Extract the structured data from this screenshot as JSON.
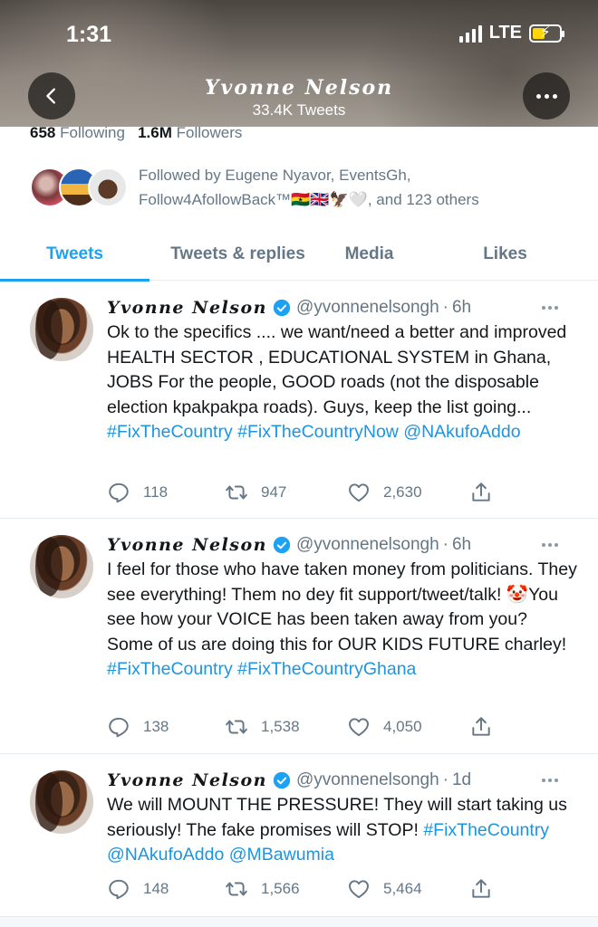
{
  "status_bar": {
    "time": "1:31",
    "network": "LTE"
  },
  "header": {
    "name": "Yvonne Nelson",
    "tweet_count": "33.4K Tweets"
  },
  "profile": {
    "following_count": "658",
    "following_label": "Following",
    "followers_count": "1.6M",
    "followers_label": "Followers",
    "followed_by": "Followed by Eugene Nyavor, EventsGh, Follow4AfollowBack™🇬🇭🇬🇧🦅🤍, and 123 others"
  },
  "tabs": [
    {
      "label": "Tweets",
      "active": true
    },
    {
      "label": "Tweets & replies",
      "active": false
    },
    {
      "label": "Media",
      "active": false
    },
    {
      "label": "Likes",
      "active": false
    }
  ],
  "colors": {
    "accent": "#1da1f2",
    "link": "#1b95e0",
    "secondary_text": "#657786"
  },
  "tweets": [
    {
      "name": "Yvonne Nelson",
      "handle": "@yvonnenelsongh",
      "time": "6h",
      "text": "Ok to the specifics .... we want/need a better and improved HEALTH SECTOR , EDUCATIONAL SYSTEM in Ghana, JOBS For the people, GOOD roads (not the disposable election kpakpakpa roads). Guys, keep the list going... ",
      "links": [
        "#FixTheCountry",
        "#FixTheCountryNow",
        "@NAkufoAddo"
      ],
      "replies": "118",
      "retweets": "947",
      "likes": "2,630"
    },
    {
      "name": "Yvonne Nelson",
      "handle": "@yvonnenelsongh",
      "time": "6h",
      "text": "I feel for those who have taken money from politicians. They see everything! Them no dey fit support/tweet/talk! 🤡You see how your VOICE has been taken away from you? Some of us are doing this for OUR KIDS FUTURE charley! ",
      "links": [
        "#FixTheCountry",
        "#FixTheCountryGhana"
      ],
      "replies": "138",
      "retweets": "1,538",
      "likes": "4,050"
    },
    {
      "name": "Yvonne Nelson",
      "handle": "@yvonnenelsongh",
      "time": "1d",
      "text": "We will MOUNT THE PRESSURE! They will start taking us seriously! The fake promises will STOP! ",
      "links": [
        "#FixTheCountry",
        "@NAkufoAddo",
        "@MBawumia"
      ],
      "replies": "148",
      "retweets": "1,566",
      "likes": "5,464"
    }
  ]
}
